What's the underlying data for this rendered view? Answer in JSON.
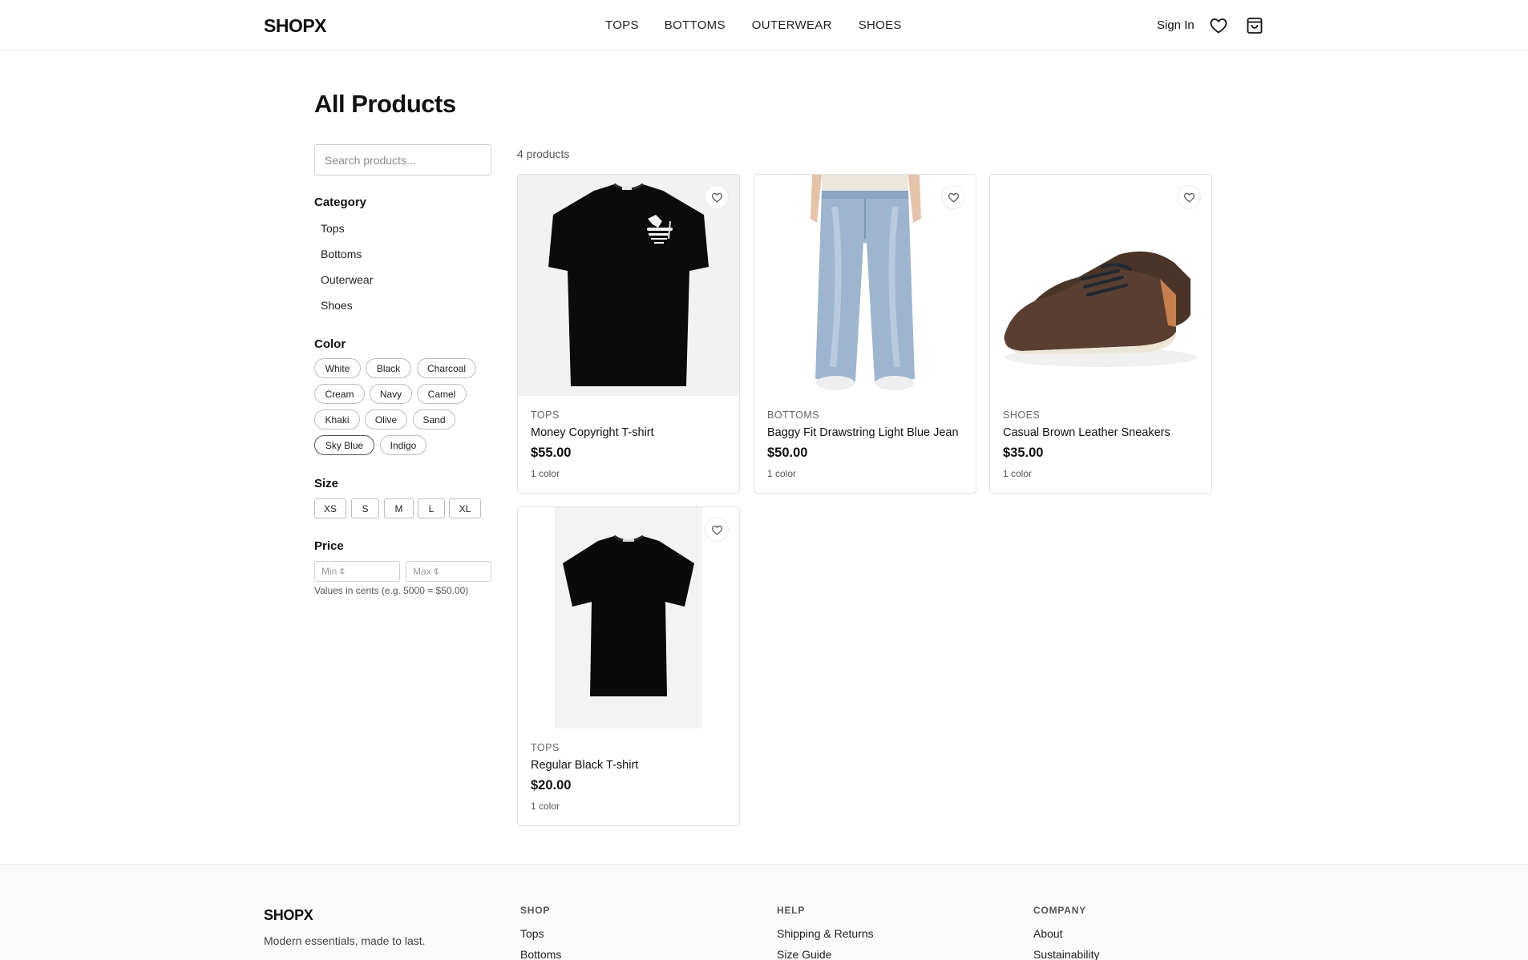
{
  "header": {
    "logo": "SHOPX",
    "nav": [
      "TOPS",
      "BOTTOMS",
      "OUTERWEAR",
      "SHOES"
    ],
    "sign_in": "Sign In",
    "icons": [
      "heart-icon",
      "shopping-bag-icon"
    ]
  },
  "page": {
    "title": "All Products"
  },
  "filters": {
    "search_placeholder": "Search products...",
    "category_heading": "Category",
    "categories": [
      "Tops",
      "Bottoms",
      "Outerwear",
      "Shoes"
    ],
    "color_heading": "Color",
    "colors": [
      "White",
      "Black",
      "Charcoal",
      "Cream",
      "Navy",
      "Camel",
      "Khaki",
      "Olive",
      "Sand",
      "Sky Blue",
      "Indigo"
    ],
    "selected_color": "Sky Blue",
    "size_heading": "Size",
    "sizes": [
      "XS",
      "S",
      "M",
      "L",
      "XL"
    ],
    "price_heading": "Price",
    "price_min_placeholder": "Min ¢",
    "price_max_placeholder": "Max ¢",
    "price_note": "Values in cents (e.g. 5000 = $50.00)"
  },
  "results": {
    "count": "4 products",
    "products": [
      {
        "category": "TOPS",
        "name": "Money Copyright T-shirt",
        "price": "$55.00",
        "colors": "1 color",
        "image": "black-graphic-tshirt"
      },
      {
        "category": "BOTTOMS",
        "name": "Baggy Fit Drawstring Light Blue Jean",
        "price": "$50.00",
        "colors": "1 color",
        "image": "light-blue-baggy-jeans"
      },
      {
        "category": "SHOES",
        "name": "Casual Brown Leather Sneakers",
        "price": "$35.00",
        "colors": "1 color",
        "image": "brown-leather-sneakers"
      },
      {
        "category": "TOPS",
        "name": "Regular Black T-shirt",
        "price": "$20.00",
        "colors": "1 color",
        "image": "plain-black-tshirt"
      }
    ]
  },
  "footer": {
    "logo": "SHOPX",
    "tagline": "Modern essentials, made to last.",
    "columns": [
      {
        "heading": "SHOP",
        "links": [
          "Tops",
          "Bottoms"
        ]
      },
      {
        "heading": "HELP",
        "links": [
          "Shipping & Returns",
          "Size Guide"
        ]
      },
      {
        "heading": "COMPANY",
        "links": [
          "About",
          "Sustainability"
        ]
      }
    ]
  },
  "colors": {
    "text": "#111111",
    "border": "#e2e2e2",
    "muted": "#555555",
    "footer_bg": "#fafafa"
  }
}
